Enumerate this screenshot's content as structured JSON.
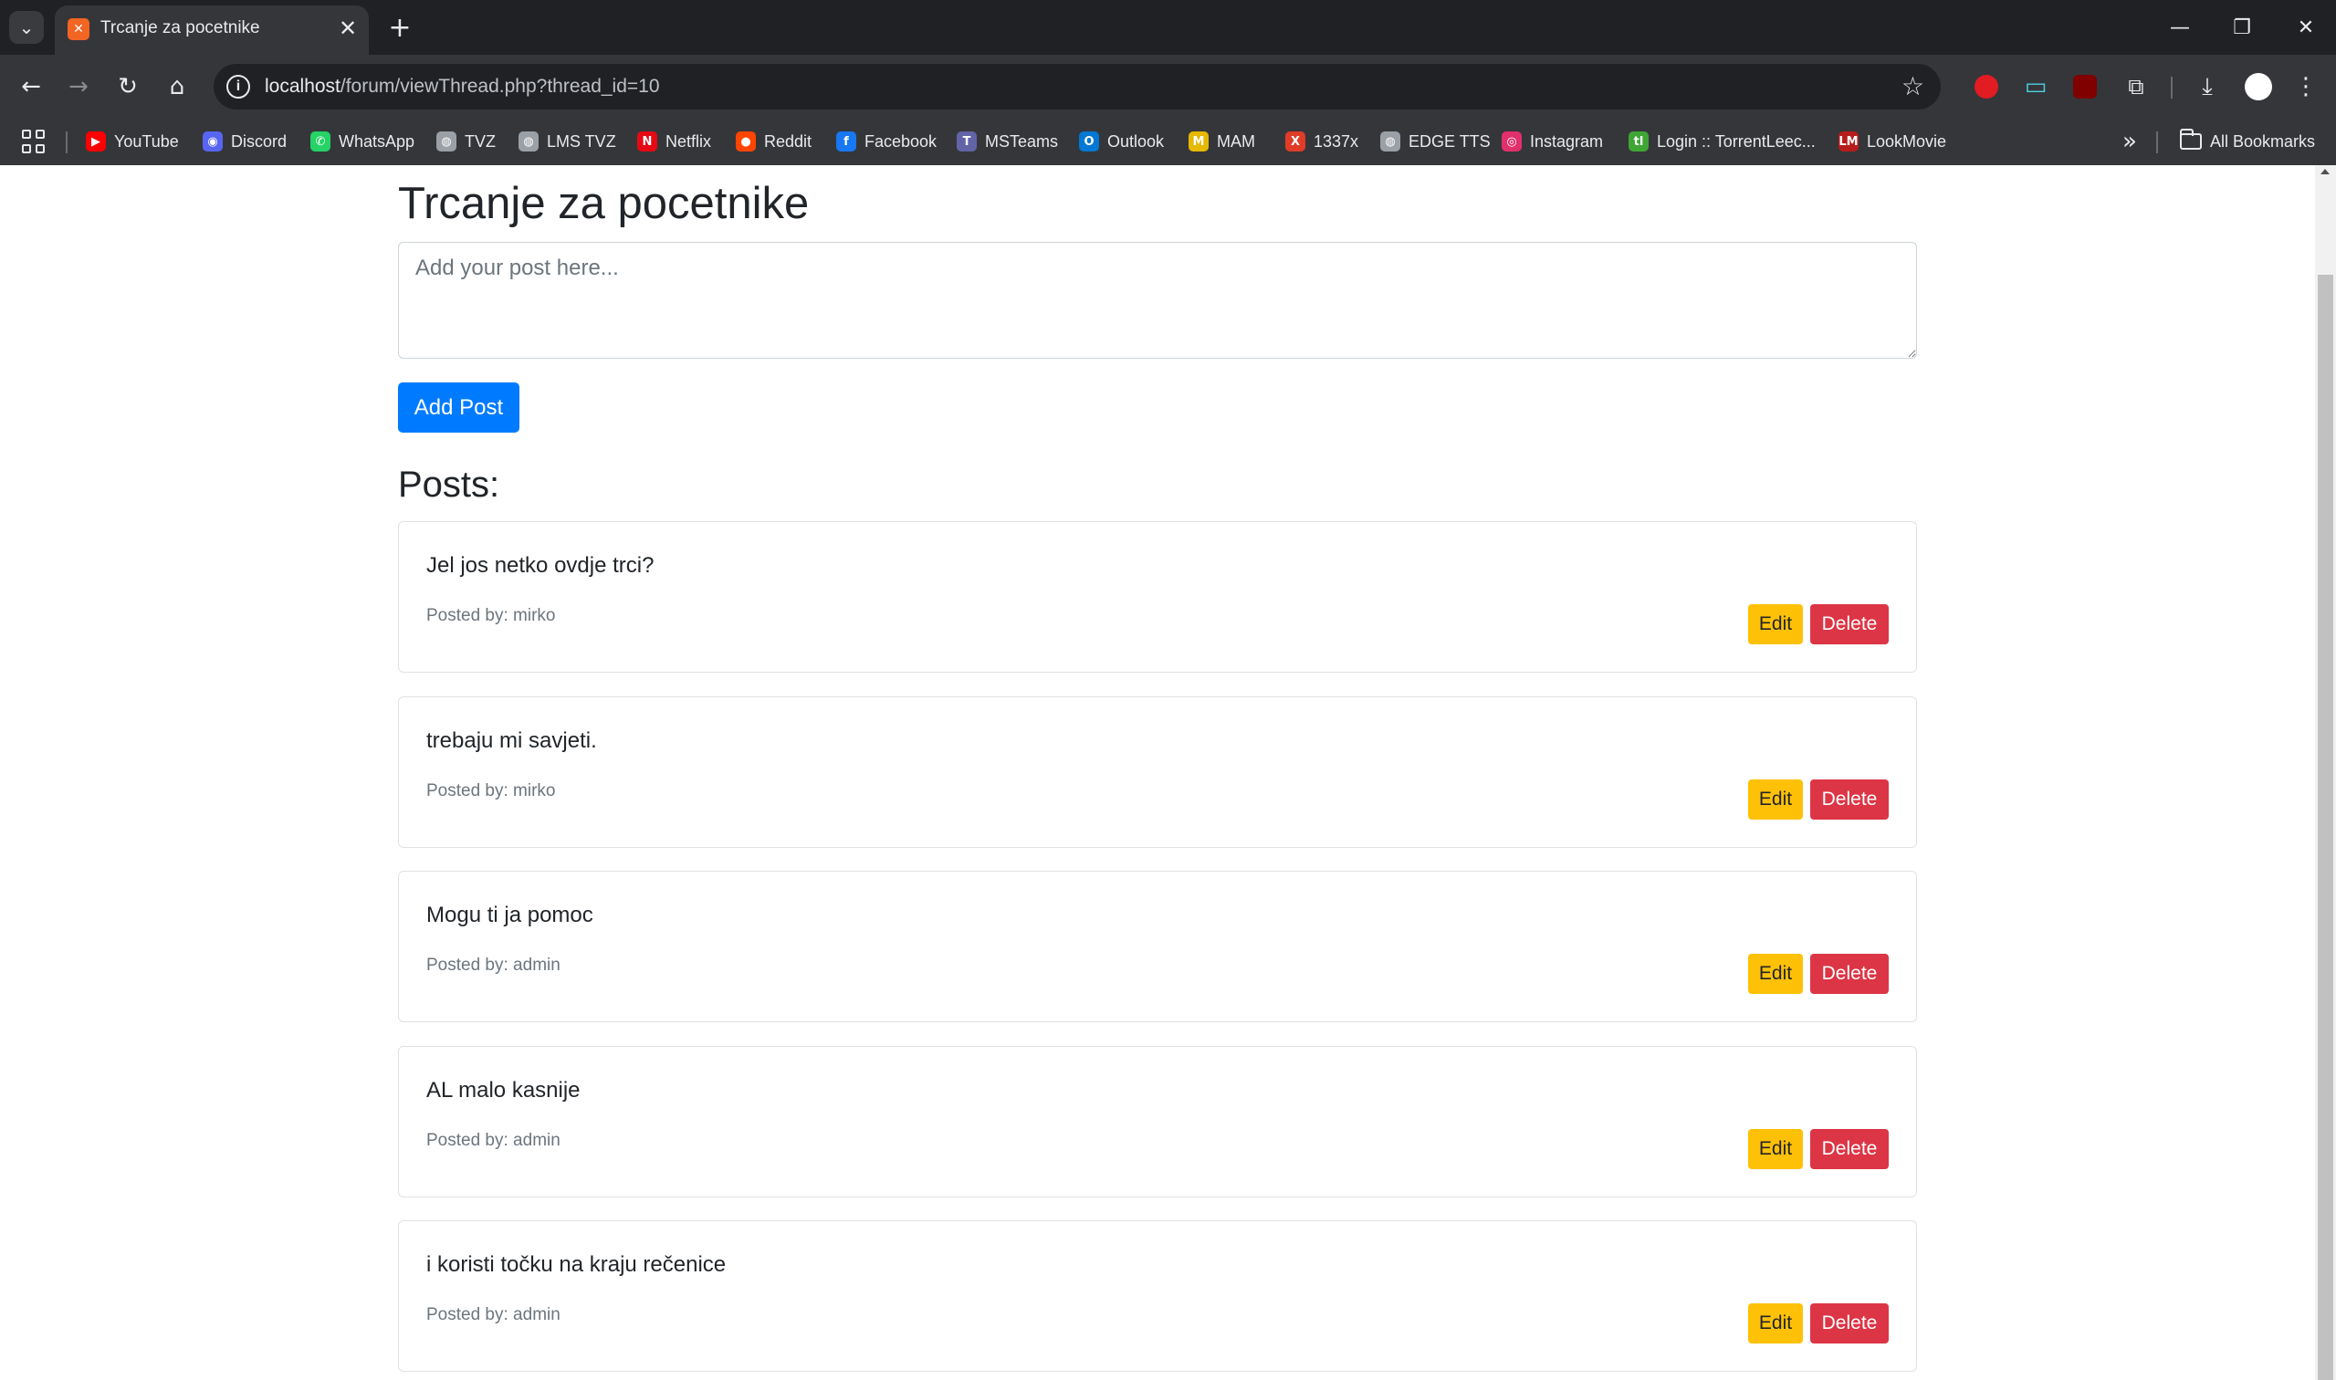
{
  "browser": {
    "tab": {
      "title": "Trcanje za pocetnike",
      "favicon": "xampp-icon"
    },
    "address": {
      "host": "localhost",
      "path": "/forum/viewThread.php?thread_id=10"
    },
    "bookmarks": [
      {
        "label": "YouTube",
        "icon": "youtube-icon",
        "color": "#ff0000"
      },
      {
        "label": "Discord",
        "icon": "discord-icon",
        "color": "#5865f2"
      },
      {
        "label": "WhatsApp",
        "icon": "whatsapp-icon",
        "color": "#25d366"
      },
      {
        "label": "TVZ",
        "icon": "globe-icon",
        "color": "#9aa0a6"
      },
      {
        "label": "LMS TVZ",
        "icon": "globe-icon",
        "color": "#9aa0a6"
      },
      {
        "label": "Netflix",
        "icon": "netflix-icon",
        "color": "#e50914"
      },
      {
        "label": "Reddit",
        "icon": "reddit-icon",
        "color": "#ff4500"
      },
      {
        "label": "Facebook",
        "icon": "facebook-icon",
        "color": "#1877f2"
      },
      {
        "label": "MSTeams",
        "icon": "teams-icon",
        "color": "#6264a7"
      },
      {
        "label": "Outlook",
        "icon": "outlook-icon",
        "color": "#0078d4"
      },
      {
        "label": "MAM",
        "icon": "mam-icon",
        "color": "#e6b800"
      },
      {
        "label": "1337x",
        "icon": "x-icon",
        "color": "#e03c28"
      },
      {
        "label": "EDGE TTS",
        "icon": "globe-icon",
        "color": "#9aa0a6"
      },
      {
        "label": "Instagram",
        "icon": "instagram-icon",
        "color": "#e1306c"
      },
      {
        "label": "Login :: TorrentLeec...",
        "icon": "torrentleech-icon",
        "color": "#3fa535"
      },
      {
        "label": "LookMovie",
        "icon": "lookmovie-icon",
        "color": "#b71c1c"
      }
    ],
    "all_bookmarks_label": "All Bookmarks"
  },
  "thread": {
    "title": "Trcanje za pocetnike",
    "post_placeholder": "Add your post here...",
    "add_post_label": "Add Post",
    "posts_heading": "Posts:"
  },
  "posts": [
    {
      "content": "Jel jos netko ovdje trci?",
      "meta": "Posted by: mirko",
      "edit_label": "Edit",
      "delete_label": "Delete"
    },
    {
      "content": "trebaju mi savjeti.",
      "meta": "Posted by: mirko",
      "edit_label": "Edit",
      "delete_label": "Delete"
    },
    {
      "content": "Mogu ti ja pomoc",
      "meta": "Posted by: admin",
      "edit_label": "Edit",
      "delete_label": "Delete"
    },
    {
      "content": "AL malo kasnije",
      "meta": "Posted by: admin",
      "edit_label": "Edit",
      "delete_label": "Delete"
    },
    {
      "content": "i koristi točku na kraju rečenice",
      "meta": "Posted by: admin",
      "edit_label": "Edit",
      "delete_label": "Delete"
    }
  ],
  "colors": {
    "primary": "#007bff",
    "warning": "#ffc107",
    "danger": "#dc3545",
    "chrome_dark": "#202124",
    "chrome_toolbar": "#35363a"
  }
}
